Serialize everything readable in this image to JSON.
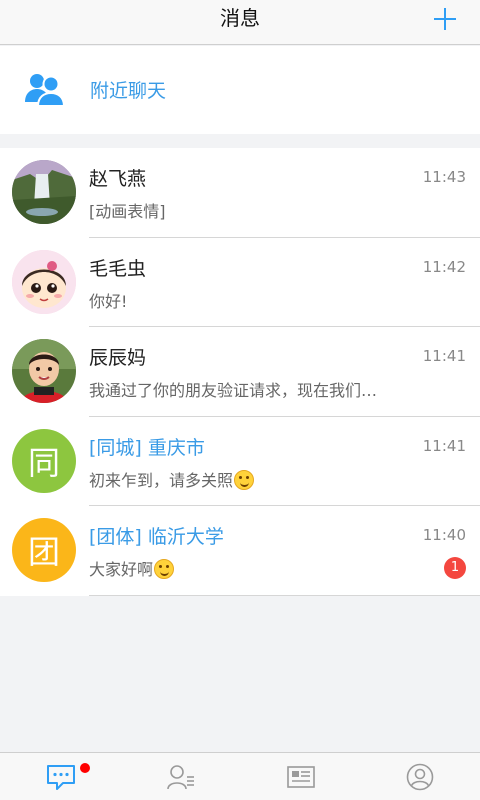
{
  "header": {
    "title": "消息",
    "add_icon": "plus-icon"
  },
  "nearby": {
    "icon": "people-icon",
    "label": "附近聊天"
  },
  "conversations": [
    {
      "name": "赵飞燕",
      "time": "11:43",
      "message": "[动画表情]",
      "avatar": "waterfall-photo",
      "unread": null
    },
    {
      "name": "毛毛虫",
      "time": "11:42",
      "message": "你好!",
      "avatar": "cartoon-girl",
      "unread": null
    },
    {
      "name": "辰辰妈",
      "time": "11:41",
      "message": "我通过了你的朋友验证请求，现在我们…",
      "avatar": "child-photo",
      "unread": null
    },
    {
      "name": "[同城] 重庆市",
      "time": "11:41",
      "message": "初来乍到，请多关照",
      "avatar_text": "同",
      "avatar_color": "#8dc63f",
      "unread": null
    },
    {
      "name": "[团体] 临沂大学",
      "time": "11:40",
      "message": "大家好啊",
      "avatar_text": "团",
      "avatar_color": "#fbb619",
      "unread": "1"
    }
  ],
  "colors": {
    "accent": "#3a9be6",
    "badge": "#f4473f"
  },
  "tabbar": {
    "tabs": [
      "messages-icon",
      "contacts-icon",
      "news-icon",
      "profile-icon"
    ],
    "active": "messages-icon"
  }
}
